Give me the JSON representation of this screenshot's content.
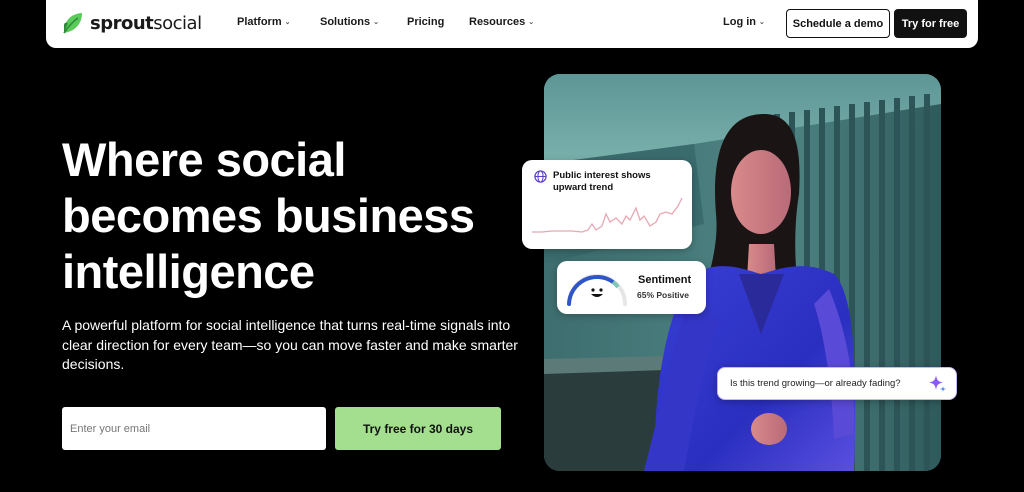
{
  "nav": {
    "logo_bold": "sprout",
    "logo_light": "social",
    "items": [
      {
        "label": "Platform",
        "dropdown": true
      },
      {
        "label": "Solutions",
        "dropdown": true
      },
      {
        "label": "Pricing",
        "dropdown": false
      },
      {
        "label": "Resources",
        "dropdown": true
      }
    ],
    "login": "Log in",
    "demo_button": "Schedule a demo",
    "try_button": "Try for free"
  },
  "hero": {
    "headline": [
      "Where social",
      "becomes business",
      "intelligence"
    ],
    "subtext": "A powerful platform for social intelligence that turns real-time signals into clear direction for every team—so you can move faster and make smarter decisions.",
    "email_placeholder": "Enter your email",
    "cta_label": "Try free for 30 days"
  },
  "cards": {
    "trend_title": "Public interest shows upward trend",
    "sentiment_title": "Sentiment",
    "sentiment_value": "65% Positive",
    "sentiment_fraction": 0.65,
    "question": "Is this trend growing—or already fading?"
  },
  "colors": {
    "background": "#000000",
    "cta_green": "#a3df8f",
    "brand_green": "#59cb59",
    "accent_purple": "#8a5cf6",
    "trend_pink": "#e8a7b3"
  },
  "icons": [
    "sprout-logo-icon",
    "chevron-down-icon",
    "globe-icon",
    "smiley-icon",
    "sparkle-icon"
  ]
}
